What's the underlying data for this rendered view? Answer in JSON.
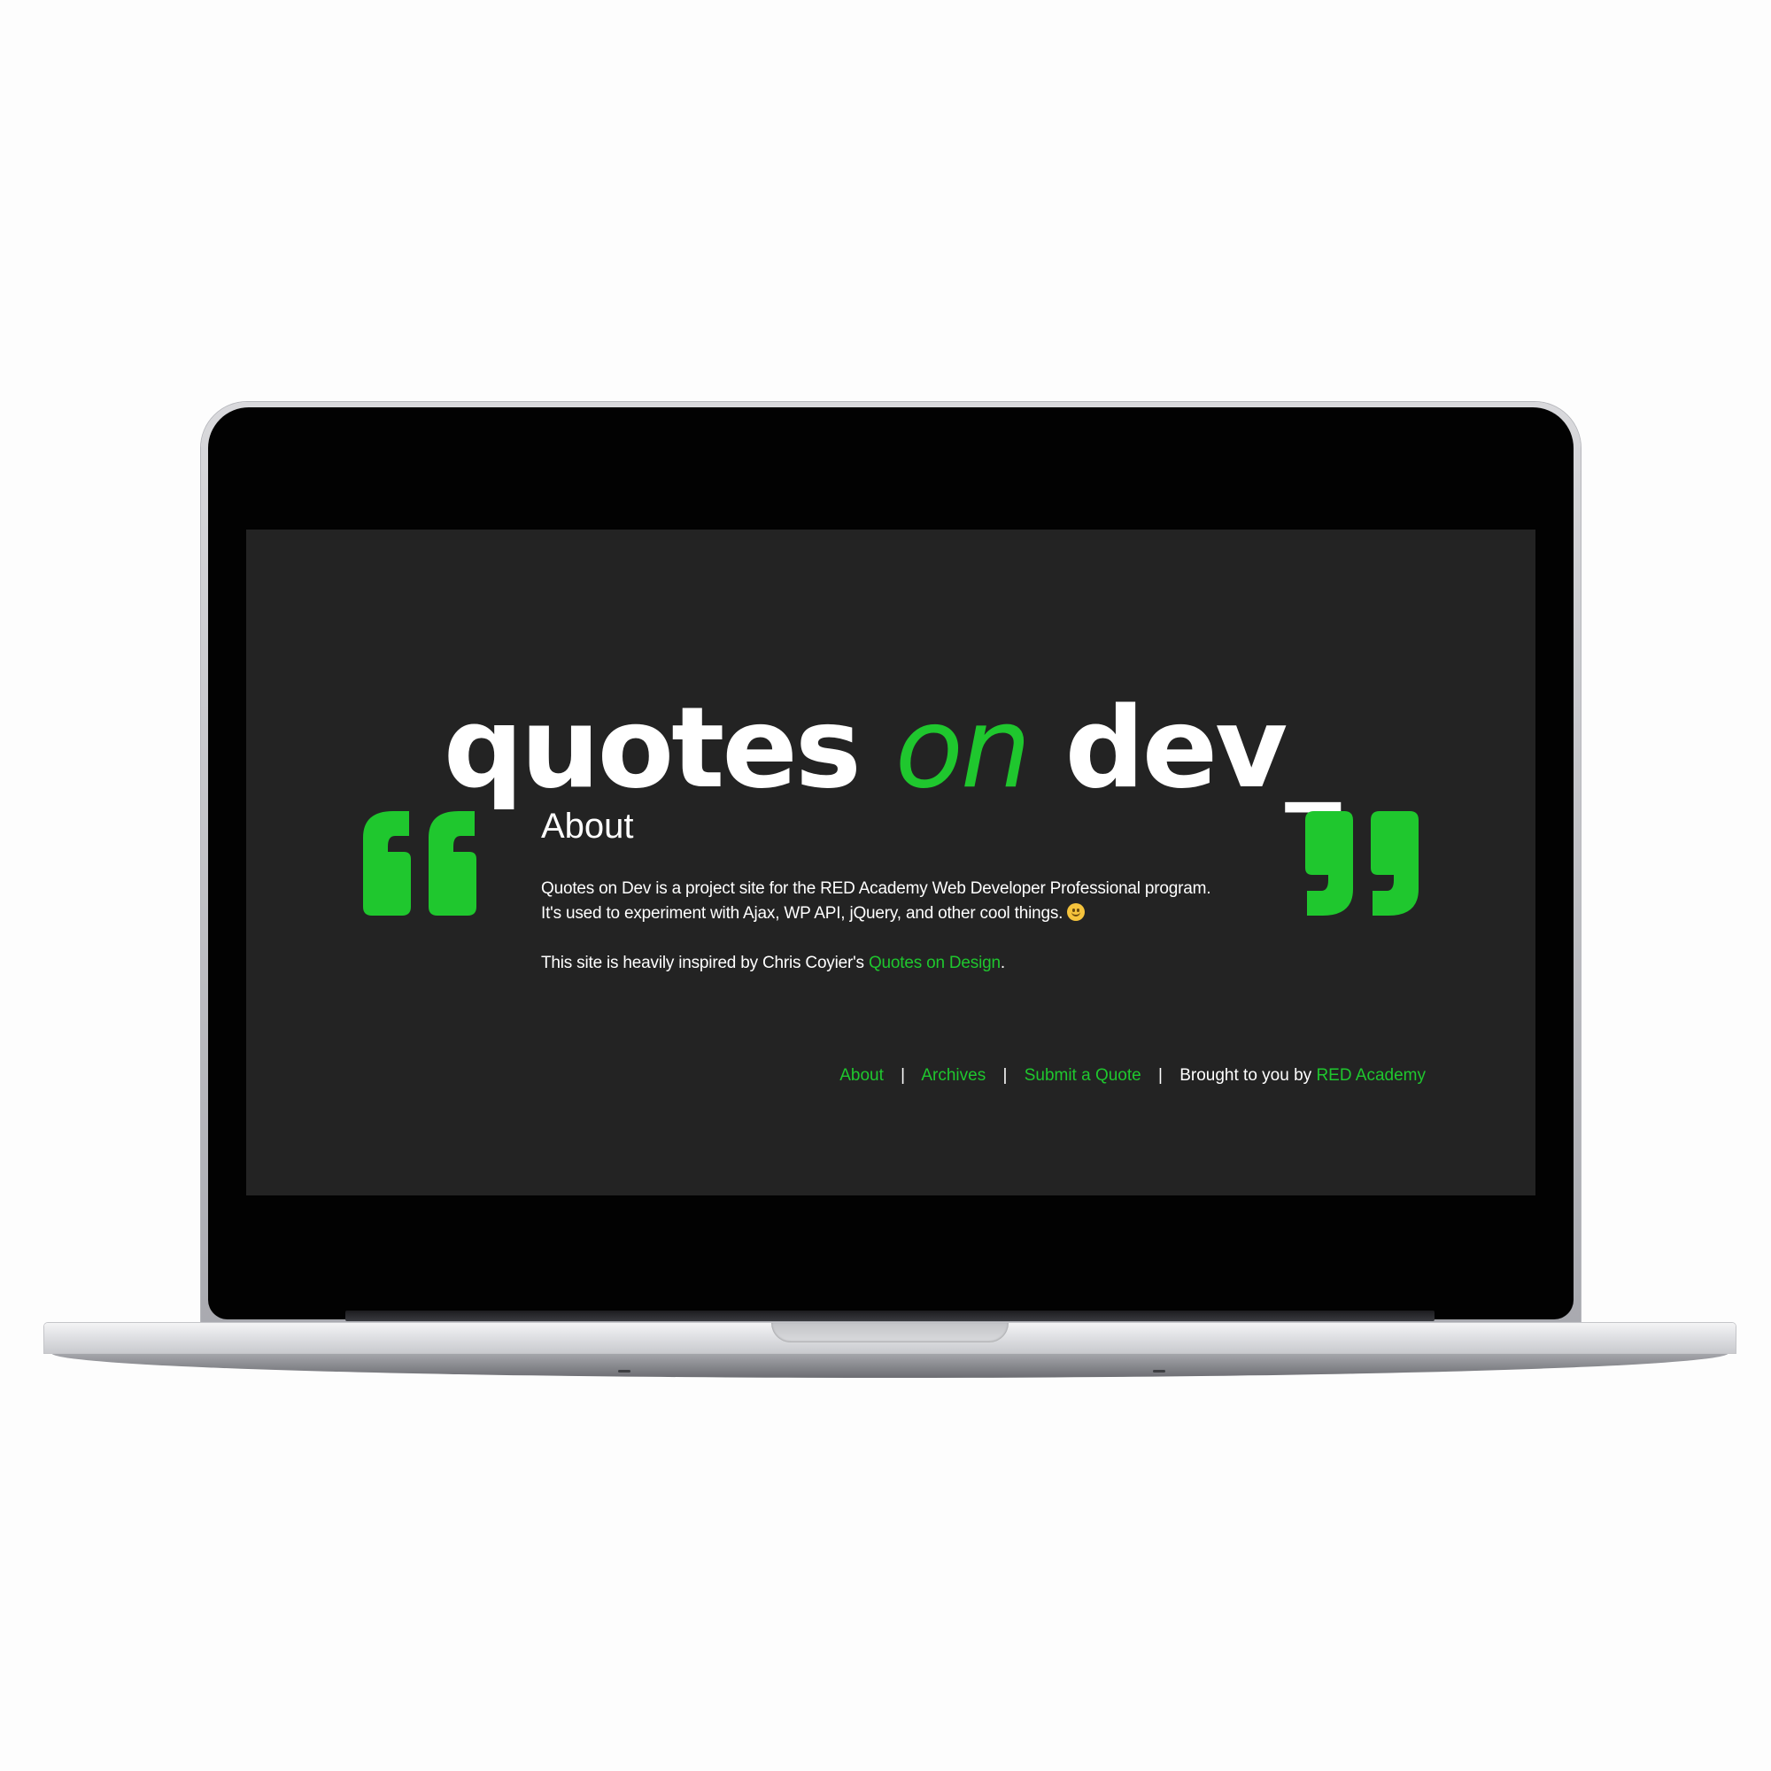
{
  "site": {
    "logo_quotes": "quotes ",
    "logo_on": "on",
    "logo_dev": " dev_"
  },
  "colors": {
    "accent": "#1fc72e",
    "screen_background": "#232323",
    "text": "#ffffff"
  },
  "icons": {
    "left_quote": "open-quote-icon",
    "right_quote": "close-quote-icon",
    "emoji": "slightly-smiling-face-icon"
  },
  "entry": {
    "title": "About",
    "paragraph1_line1": "Quotes on Dev is a project site for the RED Academy Web Developer Professional program.",
    "paragraph1_line2": "It's used to experiment with Ajax, WP API, jQuery, and other cool things.",
    "paragraph2_prefix": "This site is heavily inspired by Chris Coyier's ",
    "paragraph2_link": "Quotes on Design",
    "paragraph2_suffix": "."
  },
  "footer": {
    "nav": [
      "About",
      "Archives",
      "Submit a Quote"
    ],
    "separator": "|",
    "credit_prefix": "Brought to you by ",
    "credit_link": "RED Academy"
  }
}
